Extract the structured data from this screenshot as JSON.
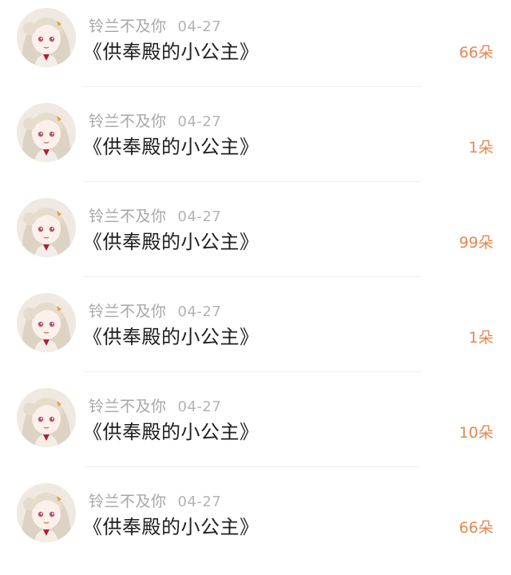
{
  "colors": {
    "gift_text": "#e4884f",
    "username_text": "#a6a6a6",
    "content_text": "#1e1e1e",
    "divider": "#efefef"
  },
  "items": [
    {
      "username": "铃兰不及你",
      "date": "04-27",
      "content": "《供奉殿的小公主》",
      "gift": "66朵",
      "avatar_icon": "anime-girl-avatar-icon"
    },
    {
      "username": "铃兰不及你",
      "date": "04-27",
      "content": "《供奉殿的小公主》",
      "gift": "1朵",
      "avatar_icon": "anime-girl-avatar-icon"
    },
    {
      "username": "铃兰不及你",
      "date": "04-27",
      "content": "《供奉殿的小公主》",
      "gift": "99朵",
      "avatar_icon": "anime-girl-avatar-icon"
    },
    {
      "username": "铃兰不及你",
      "date": "04-27",
      "content": "《供奉殿的小公主》",
      "gift": "1朵",
      "avatar_icon": "anime-girl-avatar-icon"
    },
    {
      "username": "铃兰不及你",
      "date": "04-27",
      "content": "《供奉殿的小公主》",
      "gift": "10朵",
      "avatar_icon": "anime-girl-avatar-icon"
    },
    {
      "username": "铃兰不及你",
      "date": "04-27",
      "content": "《供奉殿的小公主》",
      "gift": "66朵",
      "avatar_icon": "anime-girl-avatar-icon"
    }
  ]
}
